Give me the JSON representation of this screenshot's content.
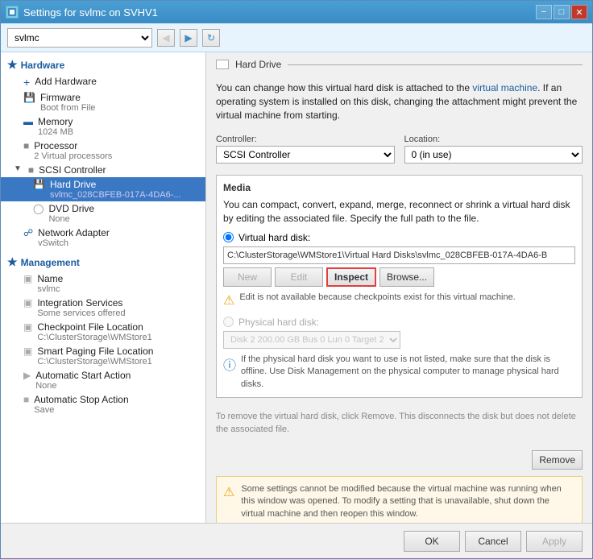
{
  "window": {
    "title": "Settings for svlmc on SVHV1",
    "vm_select": "svlmc"
  },
  "sidebar": {
    "hardware_label": "Hardware",
    "items": [
      {
        "id": "add-hardware",
        "label": "Add Hardware",
        "sub": "",
        "icon": "add",
        "level": 1
      },
      {
        "id": "firmware",
        "label": "Firmware",
        "sub": "Boot from File",
        "icon": "firmware",
        "level": 1
      },
      {
        "id": "memory",
        "label": "Memory",
        "sub": "1024 MB",
        "icon": "memory",
        "level": 1
      },
      {
        "id": "processor",
        "label": "Processor",
        "sub": "2 Virtual processors",
        "icon": "processor",
        "level": 1
      },
      {
        "id": "scsi-controller",
        "label": "SCSI Controller",
        "sub": "",
        "icon": "scsi",
        "level": 1
      },
      {
        "id": "hard-drive",
        "label": "Hard Drive",
        "sub": "svlmc_028CBFEB-017A-4DA6-...",
        "icon": "hdd",
        "level": 2,
        "selected": true
      },
      {
        "id": "dvd-drive",
        "label": "DVD Drive",
        "sub": "None",
        "icon": "dvd",
        "level": 2
      },
      {
        "id": "network-adapter",
        "label": "Network Adapter",
        "sub": "vSwitch",
        "icon": "network",
        "level": 1
      }
    ],
    "management_label": "Management",
    "mgmt_items": [
      {
        "id": "name",
        "label": "Name",
        "sub": "svlmc",
        "icon": "name"
      },
      {
        "id": "integration-services",
        "label": "Integration Services",
        "sub": "Some services offered",
        "icon": "integration"
      },
      {
        "id": "checkpoint",
        "label": "Checkpoint File Location",
        "sub": "C:\\ClusterStorage\\WMStore1",
        "icon": "checkpoint"
      },
      {
        "id": "smart-paging",
        "label": "Smart Paging File Location",
        "sub": "C:\\ClusterStorage\\WMStore1",
        "icon": "smartpaging"
      },
      {
        "id": "auto-start",
        "label": "Automatic Start Action",
        "sub": "None",
        "icon": "autostart"
      },
      {
        "id": "auto-stop",
        "label": "Automatic Stop Action",
        "sub": "Save",
        "icon": "autostop"
      }
    ]
  },
  "detail": {
    "section_title": "Hard Drive",
    "info_text": "You can change how this virtual hard disk is attached to the virtual machine. If an operating system is installed on this disk, changing the attachment might prevent the virtual machine from starting.",
    "controller_label": "Controller:",
    "controller_value": "SCSI Controller",
    "location_label": "Location:",
    "location_value": "0 (in use)",
    "media_title": "Media",
    "media_info": "You can compact, convert, expand, merge, reconnect or shrink a virtual hard disk by editing the associated file. Specify the full path to the file.",
    "virtual_disk_label": "Virtual hard disk:",
    "virtual_disk_path": "C:\\ClusterStorage\\WMStore1\\Virtual Hard Disks\\svlmc_028CBFEB-017A-4DA6-B",
    "btn_new": "New",
    "btn_edit": "Edit",
    "btn_inspect": "Inspect",
    "btn_browse": "Browse...",
    "edit_warning": "Edit is not available because checkpoints exist for this virtual machine.",
    "physical_disk_label": "Physical hard disk:",
    "physical_disk_value": "Disk 2 200.00 GB Bus 0 Lun 0 Target 2",
    "physical_info": "If the physical hard disk you want to use is not listed, make sure that the disk is offline. Use Disk Management on the physical computer to manage physical hard disks.",
    "remove_info": "To remove the virtual hard disk, click Remove. This disconnects the disk but does not delete the associated file.",
    "btn_remove": "Remove",
    "bottom_warning": "Some settings cannot be modified because the virtual machine was running when this window was opened. To modify a setting that is unavailable, shut down the virtual machine and then reopen this window."
  },
  "footer": {
    "ok_label": "OK",
    "cancel_label": "Cancel",
    "apply_label": "Apply"
  }
}
